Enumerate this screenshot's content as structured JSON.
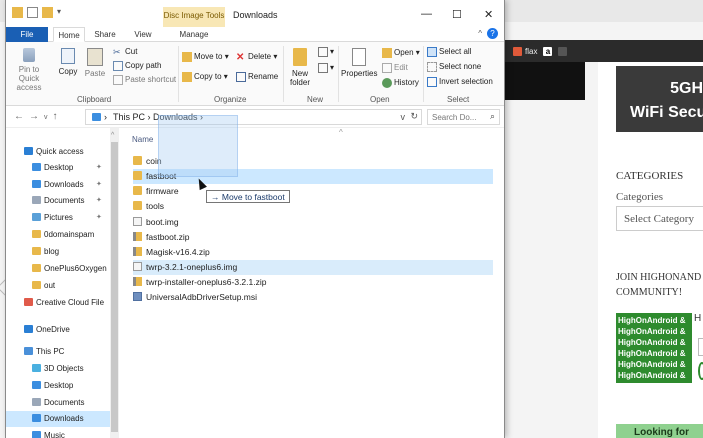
{
  "window": {
    "context_tab": "Disc Image Tools",
    "title": "Downloads",
    "minimize": "—",
    "maximize": "☐",
    "close": "✕"
  },
  "ribbon_tabs": [
    "File",
    "Home",
    "Share",
    "View",
    "Manage"
  ],
  "ribbon": {
    "clipboard": {
      "pin": "Pin to Quick access",
      "copy": "Copy",
      "paste": "Paste",
      "cut": "Cut",
      "copy_path": "Copy path",
      "paste_shortcut": "Paste shortcut",
      "label": "Clipboard"
    },
    "organize": {
      "move_to": "Move to",
      "copy_to": "Copy to",
      "delete": "Delete",
      "rename": "Rename",
      "label": "Organize"
    },
    "new": {
      "new_folder": "New folder",
      "label": "New"
    },
    "open": {
      "properties": "Properties",
      "open": "Open",
      "edit": "Edit",
      "history": "History",
      "label": "Open"
    },
    "select": {
      "select_all": "Select all",
      "select_none": "Select none",
      "invert": "Invert selection",
      "label": "Select"
    }
  },
  "address": {
    "path_root": "This PC",
    "path_folder": "Downloads",
    "search_placeholder": "Search Do..."
  },
  "nav": [
    {
      "label": "Quick access",
      "pinned": false,
      "color": "#2a7fd4"
    },
    {
      "label": "Desktop",
      "pinned": true,
      "color": "#3b8ee0"
    },
    {
      "label": "Downloads",
      "pinned": true,
      "color": "#3b8ee0"
    },
    {
      "label": "Documents",
      "pinned": true,
      "color": "#9aa7b8"
    },
    {
      "label": "Pictures",
      "pinned": true,
      "color": "#5aa0d8"
    },
    {
      "label": "0domainspam",
      "pinned": false,
      "color": "#e8b84a"
    },
    {
      "label": "blog",
      "pinned": false,
      "color": "#e8b84a"
    },
    {
      "label": "OnePlus6Oxygen",
      "pinned": false,
      "color": "#e8b84a"
    },
    {
      "label": "out",
      "pinned": false,
      "color": "#e8b84a"
    },
    {
      "label": "Creative Cloud File",
      "pinned": false,
      "color": "#e05a4a"
    },
    {
      "label": "OneDrive",
      "pinned": false,
      "color": "#2a7fd4"
    },
    {
      "label": "This PC",
      "pinned": false,
      "color": "#4a90d9"
    },
    {
      "label": "3D Objects",
      "pinned": false,
      "color": "#4ab0e0"
    },
    {
      "label": "Desktop",
      "pinned": false,
      "color": "#3b8ee0"
    },
    {
      "label": "Documents",
      "pinned": false,
      "color": "#9aa7b8"
    },
    {
      "label": "Downloads",
      "pinned": false,
      "color": "#3b8ee0"
    },
    {
      "label": "Music",
      "pinned": false,
      "color": "#3b8ee0"
    }
  ],
  "columns": {
    "name": "Name"
  },
  "files": [
    {
      "name": "coin",
      "type": "folder"
    },
    {
      "name": "fastboot",
      "type": "folder"
    },
    {
      "name": "firmware",
      "type": "folder"
    },
    {
      "name": "tools",
      "type": "folder"
    },
    {
      "name": "boot.img",
      "type": "file"
    },
    {
      "name": "fastboot.zip",
      "type": "zip"
    },
    {
      "name": "Magisk-v16.4.zip",
      "type": "zip"
    },
    {
      "name": "twrp-3.2.1-oneplus6.img",
      "type": "file"
    },
    {
      "name": "twrp-installer-oneplus6-3.2.1.zip",
      "type": "zip"
    },
    {
      "name": "UniversalAdbDriverSetup.msi",
      "type": "msi"
    }
  ],
  "drag_tooltip": "→ Move to fastboot",
  "background": {
    "bookmarks": [
      "flax",
      "a"
    ],
    "banner_line1": "5GH",
    "banner_line2": "WiFi Secu",
    "categories_heading": "CATEGORIES",
    "categories_label": "Categories",
    "categories_select": "Select Category",
    "join_line1": "JOIN HIGHONAND",
    "join_line2": "COMMUNITY!",
    "hoa_text": "HighOnAndroid &",
    "hoa_side": "H",
    "looking": "Looking for"
  }
}
